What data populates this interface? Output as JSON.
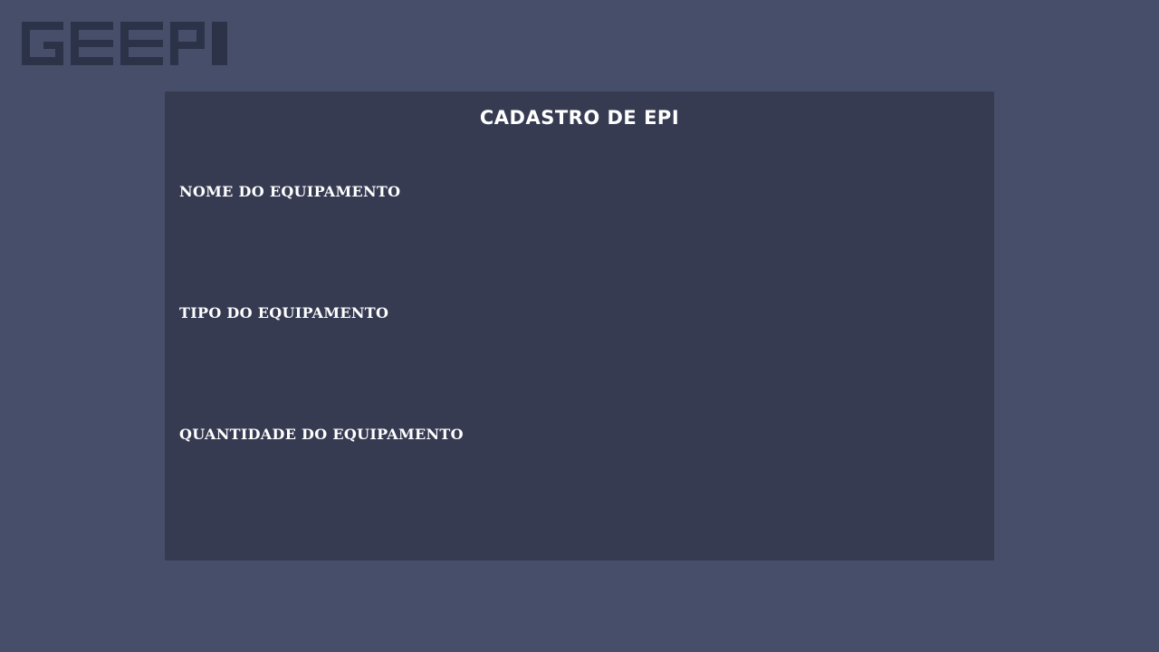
{
  "logo": {
    "text": "GEEPI",
    "color": "#2c3248"
  },
  "form": {
    "title": "CADASTRO DE EPI",
    "fields": [
      {
        "label": "NOME DO EQUIPAMENTO",
        "value": ""
      },
      {
        "label": "TIPO DO EQUIPAMENTO",
        "value": ""
      },
      {
        "label": "QUANTIDADE DO EQUIPAMENTO",
        "value": ""
      }
    ]
  },
  "colors": {
    "page_background": "#474e6a",
    "card_background": "#363b52",
    "text": "#ffffff"
  }
}
